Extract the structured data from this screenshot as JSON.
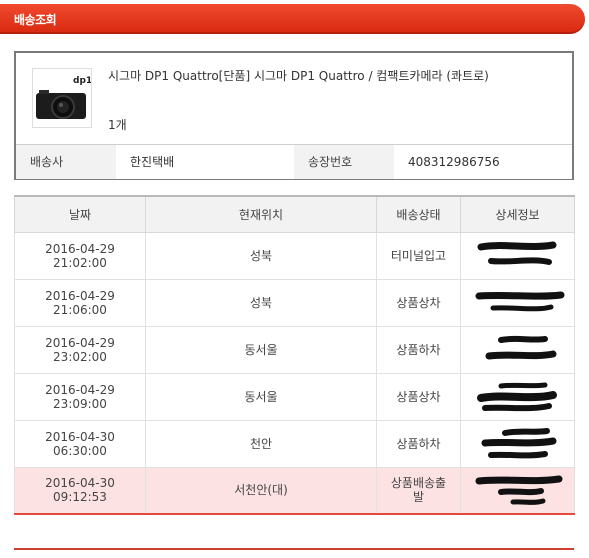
{
  "header": {
    "title": "배송조회"
  },
  "product": {
    "thumb_text": "dp1",
    "name": "시그마 DP1 Quattro[단품] 시그마 DP1 Quattro / 컴팩트카메라 (콰트로)",
    "qty": "1개"
  },
  "shipping": {
    "carrier_label": "배송사",
    "carrier_value": "한진택배",
    "invoice_label": "송장번호",
    "invoice_value": "408312986756"
  },
  "table": {
    "headers": [
      "날짜",
      "현재위치",
      "배송상태",
      "상세정보"
    ],
    "rows": [
      {
        "date": "2016-04-29",
        "time": "21:02:00",
        "location": "성북",
        "status": "터미널입고",
        "status2": ""
      },
      {
        "date": "2016-04-29",
        "time": "21:06:00",
        "location": "성북",
        "status": "상품상차",
        "status2": ""
      },
      {
        "date": "2016-04-29",
        "time": "23:02:00",
        "location": "동서울",
        "status": "상품하차",
        "status2": ""
      },
      {
        "date": "2016-04-29",
        "time": "23:09:00",
        "location": "동서울",
        "status": "상품상차",
        "status2": ""
      },
      {
        "date": "2016-04-30",
        "time": "06:30:00",
        "location": "천안",
        "status": "상품하차",
        "status2": ""
      },
      {
        "date": "2016-04-30",
        "time": "09:12:53",
        "location": "서천안(대)",
        "status": "상품배송출",
        "status2": "발"
      }
    ]
  },
  "colors": {
    "accent": "#e0321a",
    "highlight_row": "#fde2e4"
  }
}
